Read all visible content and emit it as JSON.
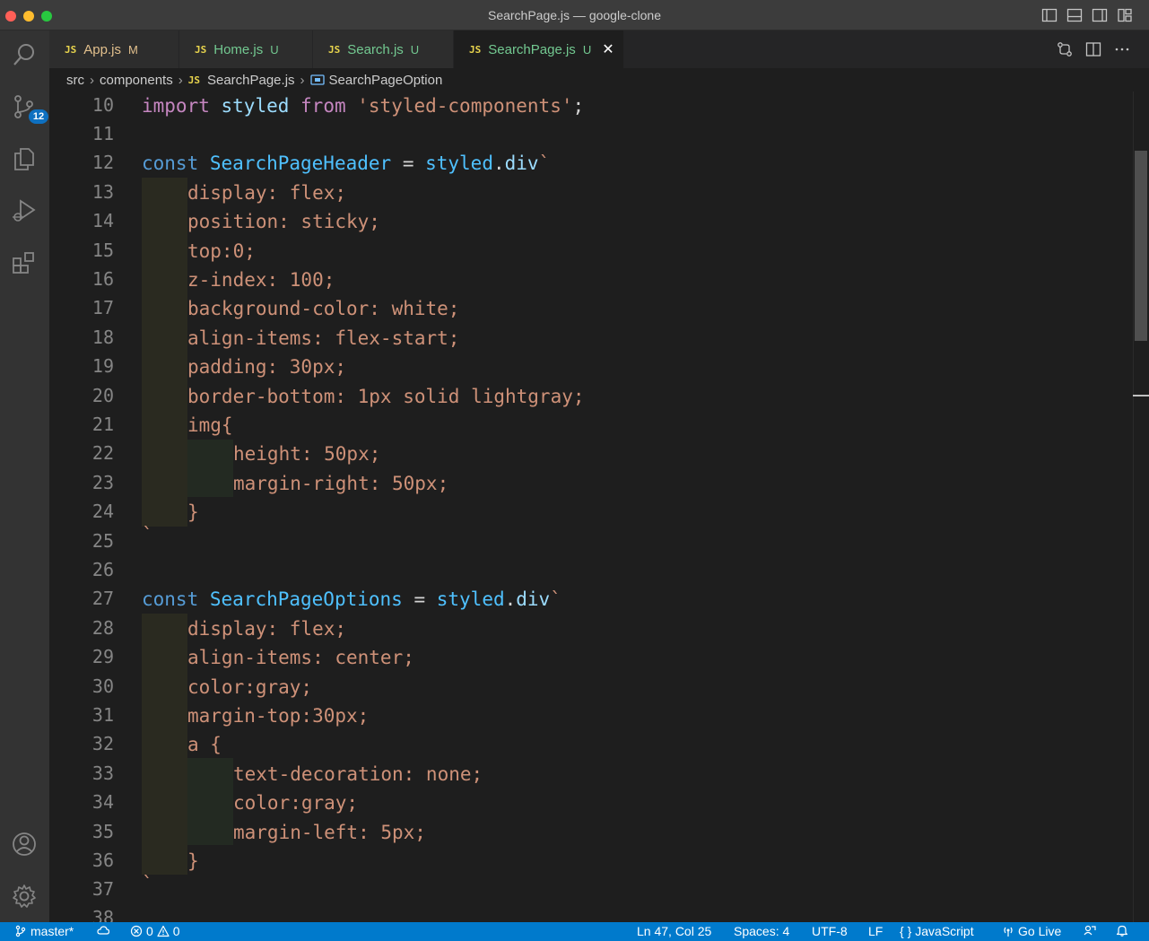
{
  "window": {
    "title": "SearchPage.js — google-clone"
  },
  "activity": {
    "source_control_badge": "12"
  },
  "tabs": [
    {
      "label": "App.js",
      "status": "M",
      "active": false
    },
    {
      "label": "Home.js",
      "status": "U",
      "active": false
    },
    {
      "label": "Search.js",
      "status": "U",
      "active": false
    },
    {
      "label": "SearchPage.js",
      "status": "U",
      "active": true
    }
  ],
  "tab_file_type": "JS",
  "tab_close": "✕",
  "breadcrumb": {
    "items": [
      "src",
      "components",
      "SearchPage.js",
      "SearchPageOption"
    ]
  },
  "code": {
    "line_numbers": [
      "10",
      "11",
      "12",
      "13",
      "14",
      "15",
      "16",
      "17",
      "18",
      "19",
      "20",
      "21",
      "22",
      "23",
      "24",
      "25",
      "26",
      "27",
      "28",
      "29",
      "30",
      "31",
      "32",
      "33",
      "34",
      "35",
      "36",
      "37",
      "38"
    ],
    "l10": {
      "a": "import",
      "b": "styled",
      "c": "from",
      "d": "'styled-components'",
      "e": ";"
    },
    "l12": {
      "a": "const",
      "b": "SearchPageHeader",
      "c": " = ",
      "d": "styled",
      "e": ".",
      "f": "div",
      "g": "`"
    },
    "l13": "display: flex;",
    "l14": "position: sticky;",
    "l15": "top:0;",
    "l16": "z-index: 100;",
    "l17": "background-color: white;",
    "l18": "align-items: flex-start;",
    "l19": "padding: 30px;",
    "l20": "border-bottom: 1px solid lightgray;",
    "l21": "img{",
    "l22": "height: 50px;",
    "l23": "margin-right: 50px;",
    "l24": "}",
    "l25": "`",
    "l27": {
      "a": "const",
      "b": "SearchPageOptions",
      "c": " = ",
      "d": "styled",
      "e": ".",
      "f": "div",
      "g": "`"
    },
    "l28": "display: flex;",
    "l29": "align-items: center;",
    "l30": "color:gray;",
    "l31": "margin-top:30px;",
    "l32": "a {",
    "l33": "text-decoration: none;",
    "l34": "color:gray;",
    "l35": "margin-left: 5px;",
    "l36": "}",
    "l37": "`"
  },
  "status": {
    "branch": "master*",
    "errors": "0",
    "warnings": "0",
    "position": "Ln 47, Col 25",
    "spaces": "Spaces: 4",
    "encoding": "UTF-8",
    "eol": "LF",
    "braces": "{ }",
    "language": "JavaScript",
    "golive": "Go Live"
  },
  "colors": {
    "accent": "#007acc",
    "added": "#73c991",
    "modified": "#e2c08d"
  }
}
